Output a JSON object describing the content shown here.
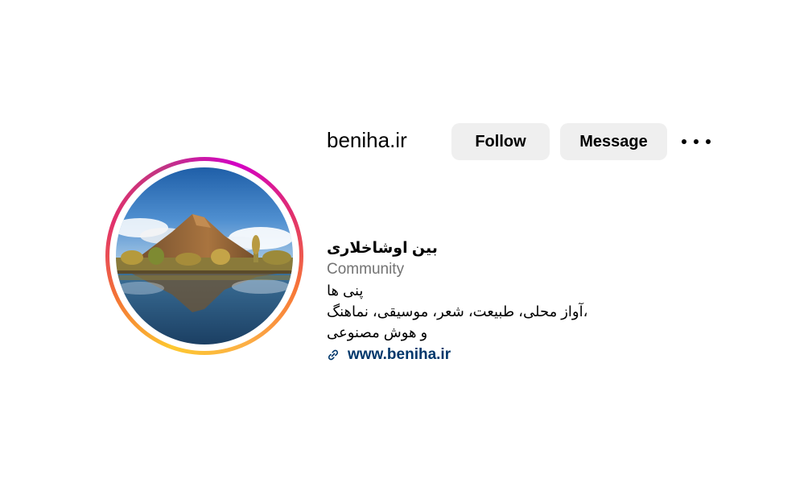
{
  "profile": {
    "username": "beniha.ir",
    "follow_label": "Follow",
    "message_label": "Message",
    "more_icon": "more-horizontal-icon"
  },
  "bio": {
    "name": "بین اوشاخلاری",
    "category": "Community",
    "lines": [
      "پنی ها",
      "،آواز محلی، طبیعت، شعر، موسیقی، نماهنگ",
      "و هوش مصنوعی"
    ],
    "link_text": "www.beniha.ir",
    "link_icon": "link-icon"
  },
  "colors": {
    "button_bg": "#efefef",
    "link": "#00376b",
    "category": "#737373"
  }
}
